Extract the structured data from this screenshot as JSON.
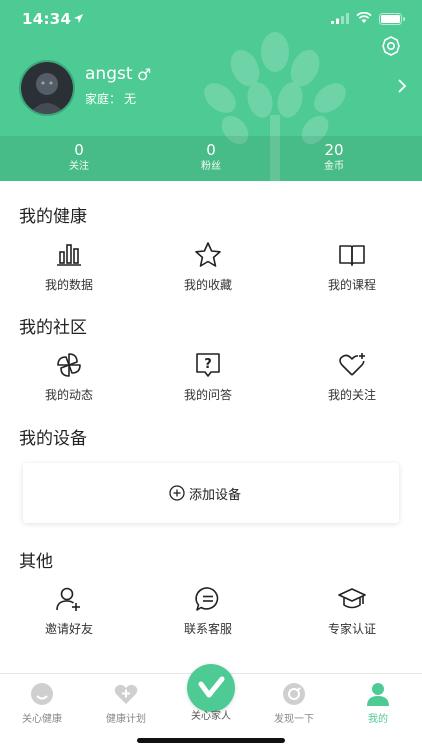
{
  "status_bar": {
    "time": "14:34"
  },
  "profile": {
    "name": "angst",
    "gender_symbol": "♂",
    "family_label": "家庭：",
    "family_value": "无"
  },
  "stats": [
    {
      "value": "0",
      "label": "关注"
    },
    {
      "value": "0",
      "label": "粉丝"
    },
    {
      "value": "20",
      "label": "金币"
    }
  ],
  "sections": {
    "health": {
      "title": "我的健康",
      "items": [
        {
          "label": "我的数据",
          "icon": "bar-chart-icon"
        },
        {
          "label": "我的收藏",
          "icon": "star-icon"
        },
        {
          "label": "我的课程",
          "icon": "book-icon"
        }
      ]
    },
    "community": {
      "title": "我的社区",
      "items": [
        {
          "label": "我的动态",
          "icon": "pinwheel-icon"
        },
        {
          "label": "我的问答",
          "icon": "question-icon"
        },
        {
          "label": "我的关注",
          "icon": "heart-plus-icon"
        }
      ]
    },
    "devices": {
      "title": "我的设备",
      "add_label": "添加设备"
    },
    "other": {
      "title": "其他",
      "items": [
        {
          "label": "邀请好友",
          "icon": "add-user-icon"
        },
        {
          "label": "联系客服",
          "icon": "chat-icon"
        },
        {
          "label": "专家认证",
          "icon": "graduation-cap-icon"
        }
      ]
    }
  },
  "tabbar": {
    "items": [
      {
        "label": "关心健康"
      },
      {
        "label": "健康计划"
      },
      {
        "label": "关心家人"
      },
      {
        "label": "发现一下"
      },
      {
        "label": "我的"
      }
    ],
    "active_index": 4
  },
  "colors": {
    "accent": "#4ecb94",
    "tab_inactive": "#cccccc",
    "text": "#222222"
  }
}
